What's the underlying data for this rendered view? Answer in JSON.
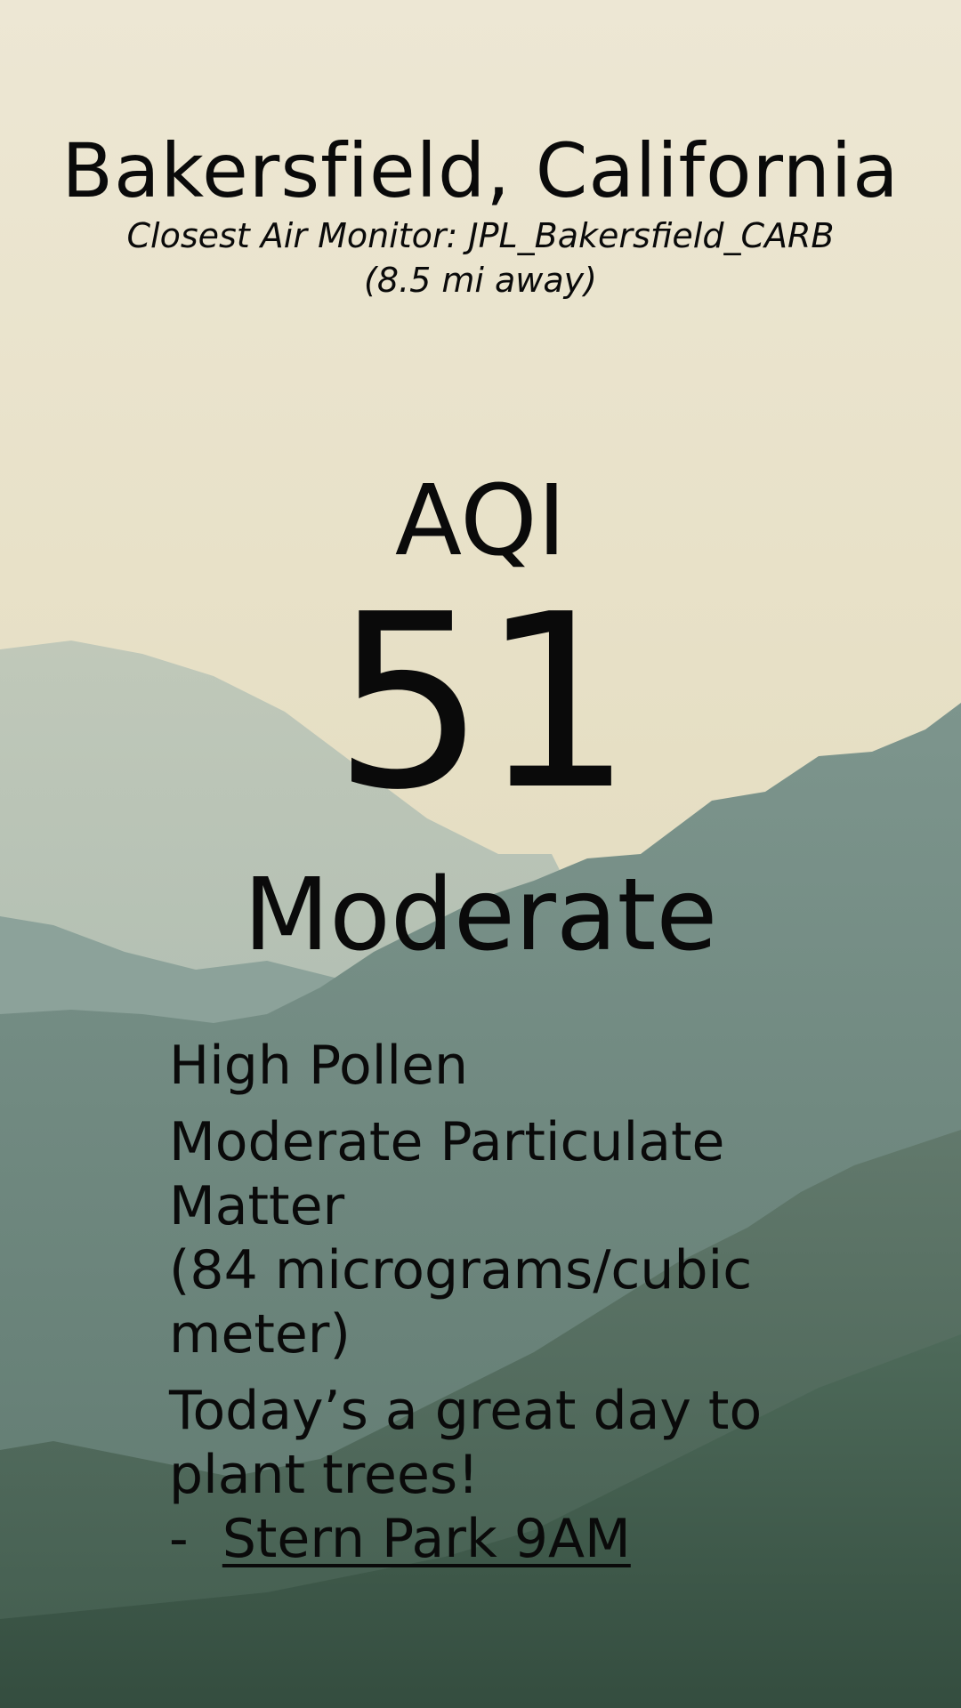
{
  "location": {
    "city": "Bakersfield, California",
    "monitor": "Closest Air Monitor: JPL_Bakersfield_CARB",
    "distance": "(8.5 mi away)"
  },
  "aqi": {
    "label": "AQI",
    "value": "51",
    "category": "Moderate"
  },
  "conditions": {
    "pollen": "High Pollen",
    "particulate_line1": "Moderate Particulate",
    "particulate_line2": "Matter",
    "particulate_line3": "(84 micrograms/cubic",
    "particulate_line4": "meter)"
  },
  "event": {
    "message_line1": "Today’s a great day to",
    "message_line2": "plant trees!",
    "dash": "-",
    "link_text": "Stern Park 9AM"
  },
  "colors": {
    "sky_top": "#ece6d2",
    "sky_bottom": "#e3dcc2",
    "mountain_far": "#93aaa5",
    "mountain_mid": "#6f8a82",
    "mountain_near": "#4f6b5f",
    "forest": "#3d5a4c",
    "text": "#0a0a0a"
  }
}
